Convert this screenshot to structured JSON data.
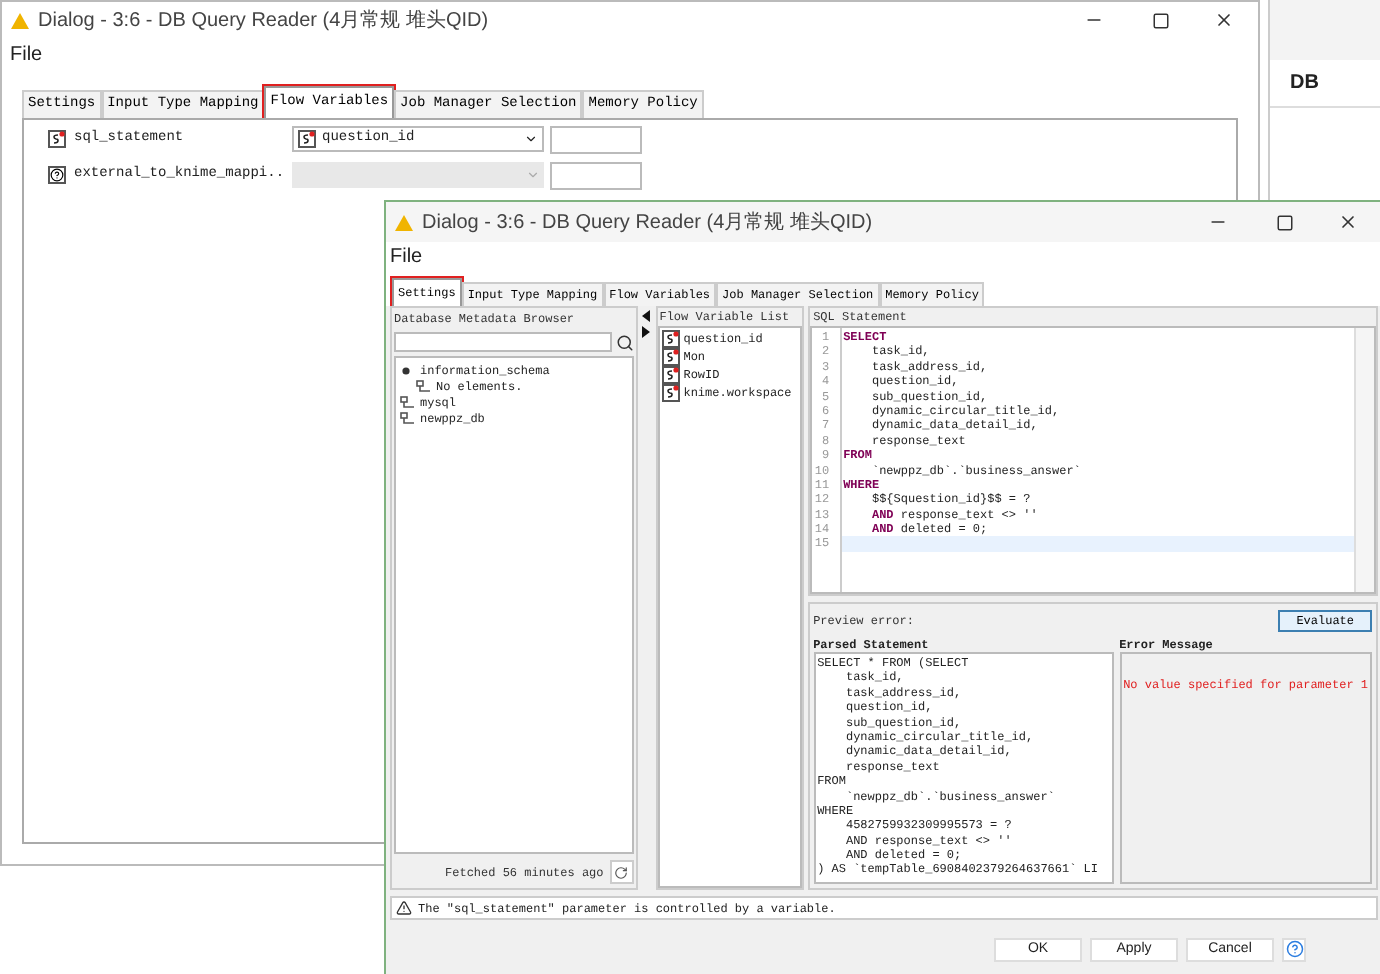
{
  "back_window": {
    "title": "Dialog - 3:6 - DB Query Reader (4月常规 堆头QID)",
    "menu": [
      "File"
    ],
    "tabs": [
      {
        "label": "Settings",
        "selected": false,
        "annotated": false
      },
      {
        "label": "Input Type Mapping",
        "selected": false,
        "annotated": false
      },
      {
        "label": "Flow Variables",
        "selected": true,
        "annotated": true
      },
      {
        "label": "Job Manager Selection",
        "selected": false,
        "annotated": false
      },
      {
        "label": "Memory Policy",
        "selected": false,
        "annotated": false
      }
    ],
    "variables": [
      {
        "name": "sql_statement",
        "kind": "string",
        "value": "question_id",
        "disabled": false
      },
      {
        "name": "external_to_knime_mappi..",
        "kind": "unknown",
        "disabled": true
      }
    ]
  },
  "side_window": {
    "title": "DB"
  },
  "front_window": {
    "title": "Dialog - 3:6 - DB Query Reader (4月常规 堆头QID)",
    "menu": [
      "File"
    ],
    "tabs": [
      {
        "label": "Settings",
        "selected": true,
        "annotated": true
      },
      {
        "label": "Input Type Mapping",
        "selected": false,
        "annotated": false
      },
      {
        "label": "Flow Variables",
        "selected": false,
        "annotated": false
      },
      {
        "label": "Job Manager Selection",
        "selected": false,
        "annotated": false
      },
      {
        "label": "Memory Policy",
        "selected": false,
        "annotated": false
      }
    ],
    "metadata_browser": {
      "title": "Database Metadata Browser",
      "tree": [
        {
          "label": "information_schema",
          "children": [
            {
              "label": "No elements."
            }
          ]
        },
        {
          "label": "mysql"
        },
        {
          "label": "newppz_db"
        }
      ],
      "status": "Fetched 56 minutes ago"
    },
    "flow_variable_list": {
      "title": "Flow Variable List",
      "items": [
        "question_id",
        "Mon",
        "RowID",
        "knime.workspace"
      ]
    },
    "sql_statement": {
      "title": "SQL Statement",
      "lines": [
        {
          "number": "1",
          "text": "**SELECT**",
          "current": false
        },
        {
          "number": "2",
          "text": "    task_id,",
          "current": false
        },
        {
          "number": "3",
          "text": "    task_address_id,",
          "current": false
        },
        {
          "number": "4",
          "text": "    question_id,",
          "current": false
        },
        {
          "number": "5",
          "text": "    sub_question_id,",
          "current": false
        },
        {
          "number": "6",
          "text": "    dynamic_circular_title_id,",
          "current": false
        },
        {
          "number": "7",
          "text": "    dynamic_data_detail_id,",
          "current": false
        },
        {
          "number": "8",
          "text": "    response_text",
          "current": false
        },
        {
          "number": "9",
          "text": "**FROM**",
          "current": false
        },
        {
          "number": "10",
          "text": "    `newppz_db`.`business_answer`",
          "current": false
        },
        {
          "number": "11",
          "text": "**WHERE**",
          "current": false
        },
        {
          "number": "12",
          "text": "    $${Squestion_id}$$ = ?",
          "current": false
        },
        {
          "number": "13",
          "text": "    **AND** response_text <> ''",
          "current": false
        },
        {
          "number": "14",
          "text": "    **AND** deleted = 0;",
          "current": false
        },
        {
          "number": "15",
          "current": true
        }
      ]
    },
    "preview": {
      "label": "Preview error:",
      "button": "Evaluate",
      "parsed_statement": {
        "title": "Parsed Statement",
        "lines": [
          "SELECT * FROM (SELECT",
          "    task_id,",
          "    task_address_id,",
          "    question_id,",
          "    sub_question_id,",
          "    dynamic_circular_title_id,",
          "    dynamic_data_detail_id,",
          "    response_text",
          "FROM",
          "    `newppz_db`.`business_answer`",
          "WHERE",
          "    4582759932309995573 = ?",
          "    AND response_text <> ''",
          "    AND deleted = 0;",
          ") AS `tempTable_6908402379264637661` LI"
        ]
      },
      "error_message": {
        "title": "Error Message",
        "text": "No value specified for parameter 1"
      }
    },
    "status_message": "The \"sql_statement\" parameter is controlled by a variable.",
    "buttons": [
      "OK",
      "Apply",
      "Cancel"
    ]
  }
}
